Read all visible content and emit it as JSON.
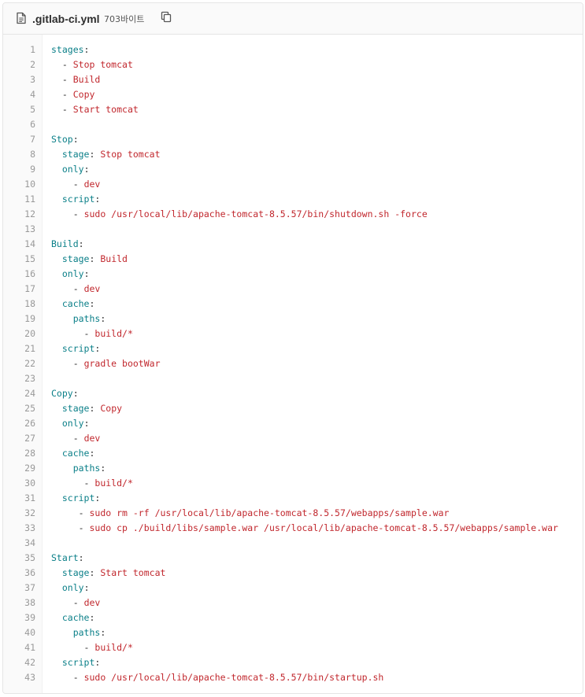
{
  "file": {
    "name": ".gitlab-ci.yml",
    "size": "703바이트"
  },
  "icons": {
    "file_icon": "document-icon",
    "copy_icon": "copy-icon"
  },
  "colors": {
    "key": "#0a7f88",
    "string": "#c1272d",
    "line_number": "#999999",
    "header_bg": "#fafafa"
  },
  "lines": [
    {
      "n": "1",
      "tokens": [
        {
          "t": "key",
          "v": "stages"
        },
        {
          "t": "colon",
          "v": ":"
        }
      ]
    },
    {
      "n": "2",
      "tokens": [
        {
          "t": "sp",
          "v": "  "
        },
        {
          "t": "dash",
          "v": "- "
        },
        {
          "t": "str",
          "v": "Stop tomcat"
        }
      ]
    },
    {
      "n": "3",
      "tokens": [
        {
          "t": "sp",
          "v": "  "
        },
        {
          "t": "dash",
          "v": "- "
        },
        {
          "t": "str",
          "v": "Build"
        }
      ]
    },
    {
      "n": "4",
      "tokens": [
        {
          "t": "sp",
          "v": "  "
        },
        {
          "t": "dash",
          "v": "- "
        },
        {
          "t": "str",
          "v": "Copy"
        }
      ]
    },
    {
      "n": "5",
      "tokens": [
        {
          "t": "sp",
          "v": "  "
        },
        {
          "t": "dash",
          "v": "- "
        },
        {
          "t": "str",
          "v": "Start tomcat"
        }
      ]
    },
    {
      "n": "6",
      "tokens": []
    },
    {
      "n": "7",
      "tokens": [
        {
          "t": "key",
          "v": "Stop"
        },
        {
          "t": "colon",
          "v": ":"
        }
      ]
    },
    {
      "n": "8",
      "tokens": [
        {
          "t": "sp",
          "v": "  "
        },
        {
          "t": "key",
          "v": "stage"
        },
        {
          "t": "colon",
          "v": ": "
        },
        {
          "t": "str",
          "v": "Stop tomcat"
        }
      ]
    },
    {
      "n": "9",
      "tokens": [
        {
          "t": "sp",
          "v": "  "
        },
        {
          "t": "key",
          "v": "only"
        },
        {
          "t": "colon",
          "v": ":"
        }
      ]
    },
    {
      "n": "10",
      "tokens": [
        {
          "t": "sp",
          "v": "    "
        },
        {
          "t": "dash",
          "v": "- "
        },
        {
          "t": "str",
          "v": "dev"
        }
      ]
    },
    {
      "n": "11",
      "tokens": [
        {
          "t": "sp",
          "v": "  "
        },
        {
          "t": "key",
          "v": "script"
        },
        {
          "t": "colon",
          "v": ":"
        }
      ]
    },
    {
      "n": "12",
      "tokens": [
        {
          "t": "sp",
          "v": "    "
        },
        {
          "t": "dash",
          "v": "- "
        },
        {
          "t": "str",
          "v": "sudo /usr/local/lib/apache-tomcat-8.5.57/bin/shutdown.sh -force"
        }
      ]
    },
    {
      "n": "13",
      "tokens": []
    },
    {
      "n": "14",
      "tokens": [
        {
          "t": "key",
          "v": "Build"
        },
        {
          "t": "colon",
          "v": ":"
        }
      ]
    },
    {
      "n": "15",
      "tokens": [
        {
          "t": "sp",
          "v": "  "
        },
        {
          "t": "key",
          "v": "stage"
        },
        {
          "t": "colon",
          "v": ": "
        },
        {
          "t": "str",
          "v": "Build"
        }
      ]
    },
    {
      "n": "16",
      "tokens": [
        {
          "t": "sp",
          "v": "  "
        },
        {
          "t": "key",
          "v": "only"
        },
        {
          "t": "colon",
          "v": ":"
        }
      ]
    },
    {
      "n": "17",
      "tokens": [
        {
          "t": "sp",
          "v": "    "
        },
        {
          "t": "dash",
          "v": "- "
        },
        {
          "t": "str",
          "v": "dev"
        }
      ]
    },
    {
      "n": "18",
      "tokens": [
        {
          "t": "sp",
          "v": "  "
        },
        {
          "t": "key",
          "v": "cache"
        },
        {
          "t": "colon",
          "v": ":"
        }
      ]
    },
    {
      "n": "19",
      "tokens": [
        {
          "t": "sp",
          "v": "    "
        },
        {
          "t": "key",
          "v": "paths"
        },
        {
          "t": "colon",
          "v": ":"
        }
      ]
    },
    {
      "n": "20",
      "tokens": [
        {
          "t": "sp",
          "v": "      "
        },
        {
          "t": "dash",
          "v": "- "
        },
        {
          "t": "str",
          "v": "build/*"
        }
      ]
    },
    {
      "n": "21",
      "tokens": [
        {
          "t": "sp",
          "v": "  "
        },
        {
          "t": "key",
          "v": "script"
        },
        {
          "t": "colon",
          "v": ":"
        }
      ]
    },
    {
      "n": "22",
      "tokens": [
        {
          "t": "sp",
          "v": "    "
        },
        {
          "t": "dash",
          "v": "- "
        },
        {
          "t": "str",
          "v": "gradle bootWar"
        }
      ]
    },
    {
      "n": "23",
      "tokens": []
    },
    {
      "n": "24",
      "tokens": [
        {
          "t": "key",
          "v": "Copy"
        },
        {
          "t": "colon",
          "v": ":"
        }
      ]
    },
    {
      "n": "25",
      "tokens": [
        {
          "t": "sp",
          "v": "  "
        },
        {
          "t": "key",
          "v": "stage"
        },
        {
          "t": "colon",
          "v": ": "
        },
        {
          "t": "str",
          "v": "Copy"
        }
      ]
    },
    {
      "n": "26",
      "tokens": [
        {
          "t": "sp",
          "v": "  "
        },
        {
          "t": "key",
          "v": "only"
        },
        {
          "t": "colon",
          "v": ":"
        }
      ]
    },
    {
      "n": "27",
      "tokens": [
        {
          "t": "sp",
          "v": "    "
        },
        {
          "t": "dash",
          "v": "- "
        },
        {
          "t": "str",
          "v": "dev"
        }
      ]
    },
    {
      "n": "28",
      "tokens": [
        {
          "t": "sp",
          "v": "  "
        },
        {
          "t": "key",
          "v": "cache"
        },
        {
          "t": "colon",
          "v": ":"
        }
      ]
    },
    {
      "n": "29",
      "tokens": [
        {
          "t": "sp",
          "v": "    "
        },
        {
          "t": "key",
          "v": "paths"
        },
        {
          "t": "colon",
          "v": ":"
        }
      ]
    },
    {
      "n": "30",
      "tokens": [
        {
          "t": "sp",
          "v": "      "
        },
        {
          "t": "dash",
          "v": "- "
        },
        {
          "t": "str",
          "v": "build/*"
        }
      ]
    },
    {
      "n": "31",
      "tokens": [
        {
          "t": "sp",
          "v": "  "
        },
        {
          "t": "key",
          "v": "script"
        },
        {
          "t": "colon",
          "v": ":"
        }
      ]
    },
    {
      "n": "32",
      "tokens": [
        {
          "t": "sp",
          "v": "     "
        },
        {
          "t": "dash",
          "v": "- "
        },
        {
          "t": "str",
          "v": "sudo rm -rf /usr/local/lib/apache-tomcat-8.5.57/webapps/sample.war"
        }
      ]
    },
    {
      "n": "33",
      "tokens": [
        {
          "t": "sp",
          "v": "     "
        },
        {
          "t": "dash",
          "v": "- "
        },
        {
          "t": "str",
          "v": "sudo cp ./build/libs/sample.war /usr/local/lib/apache-tomcat-8.5.57/webapps/sample.war"
        }
      ]
    },
    {
      "n": "34",
      "tokens": []
    },
    {
      "n": "35",
      "tokens": [
        {
          "t": "key",
          "v": "Start"
        },
        {
          "t": "colon",
          "v": ":"
        }
      ]
    },
    {
      "n": "36",
      "tokens": [
        {
          "t": "sp",
          "v": "  "
        },
        {
          "t": "key",
          "v": "stage"
        },
        {
          "t": "colon",
          "v": ": "
        },
        {
          "t": "str",
          "v": "Start tomcat"
        }
      ]
    },
    {
      "n": "37",
      "tokens": [
        {
          "t": "sp",
          "v": "  "
        },
        {
          "t": "key",
          "v": "only"
        },
        {
          "t": "colon",
          "v": ":"
        }
      ]
    },
    {
      "n": "38",
      "tokens": [
        {
          "t": "sp",
          "v": "    "
        },
        {
          "t": "dash",
          "v": "- "
        },
        {
          "t": "str",
          "v": "dev"
        }
      ]
    },
    {
      "n": "39",
      "tokens": [
        {
          "t": "sp",
          "v": "  "
        },
        {
          "t": "key",
          "v": "cache"
        },
        {
          "t": "colon",
          "v": ":"
        }
      ]
    },
    {
      "n": "40",
      "tokens": [
        {
          "t": "sp",
          "v": "    "
        },
        {
          "t": "key",
          "v": "paths"
        },
        {
          "t": "colon",
          "v": ":"
        }
      ]
    },
    {
      "n": "41",
      "tokens": [
        {
          "t": "sp",
          "v": "      "
        },
        {
          "t": "dash",
          "v": "- "
        },
        {
          "t": "str",
          "v": "build/*"
        }
      ]
    },
    {
      "n": "42",
      "tokens": [
        {
          "t": "sp",
          "v": "  "
        },
        {
          "t": "key",
          "v": "script"
        },
        {
          "t": "colon",
          "v": ":"
        }
      ]
    },
    {
      "n": "43",
      "tokens": [
        {
          "t": "sp",
          "v": "    "
        },
        {
          "t": "dash",
          "v": "- "
        },
        {
          "t": "str",
          "v": "sudo /usr/local/lib/apache-tomcat-8.5.57/bin/startup.sh"
        }
      ]
    }
  ]
}
